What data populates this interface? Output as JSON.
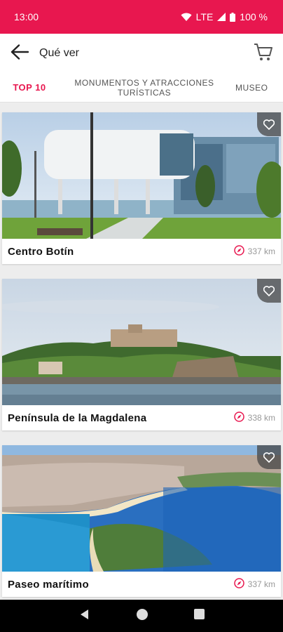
{
  "status": {
    "time": "13:00",
    "network": "LTE",
    "battery": "100 %"
  },
  "header": {
    "title": "Qué ver"
  },
  "tabs": [
    {
      "label": "TOP 10"
    },
    {
      "label": "MONUMENTOS Y ATRACCIONES TURÍSTICAS"
    },
    {
      "label": "MUSEO"
    }
  ],
  "cards": [
    {
      "title": "Centro Botín",
      "distance": "337 km"
    },
    {
      "title": "Península de la Magdalena",
      "distance": "338 km"
    },
    {
      "title": "Paseo marítimo",
      "distance": "337 km"
    }
  ],
  "colors": {
    "accent": "#e8174f"
  }
}
